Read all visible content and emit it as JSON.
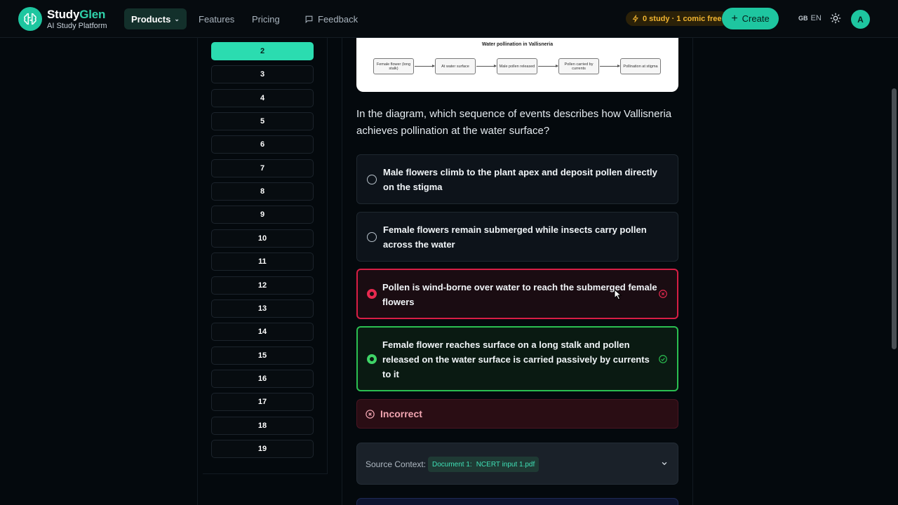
{
  "brand": {
    "name_main": "Study",
    "name_accent": "Glen",
    "tagline": "AI Study Platform"
  },
  "nav": {
    "products": "Products",
    "features": "Features",
    "pricing": "Pricing",
    "feedback": "Feedback"
  },
  "header": {
    "promo": "0 study · 1 comic free",
    "create": "Create",
    "lang_flag": "GB",
    "lang": "EN",
    "avatar": "A"
  },
  "question_nav": [
    "2",
    "3",
    "4",
    "5",
    "6",
    "7",
    "8",
    "9",
    "10",
    "11",
    "12",
    "13",
    "14",
    "15",
    "16",
    "17",
    "18",
    "19"
  ],
  "current_question": "2",
  "diagram": {
    "title": "Water pollination in Vallisneria",
    "steps": [
      "Female flower (long stalk)",
      "At water surface",
      "Male pollen released",
      "Pollen carried by currents",
      "Pollination at stigma"
    ]
  },
  "question": "In the diagram, which sequence of events describes how Vallisneria achieves pollination at the water surface?",
  "options": [
    {
      "text": "Male flowers climb to the plant apex and deposit pollen directly on the stigma",
      "state": "default"
    },
    {
      "text": "Female flowers remain submerged while insects carry pollen across the water",
      "state": "default"
    },
    {
      "text": "Pollen is wind-borne over water to reach the submerged female flowers",
      "state": "wrong"
    },
    {
      "text": "Female flower reaches surface on a long stalk and pollen released on the water surface is carried passively by currents to it",
      "state": "right"
    }
  ],
  "feedback": "Incorrect",
  "source": {
    "label": "Source Context:",
    "doc": "Document 1:",
    "file": "NCERT input 1.pdf"
  },
  "colors": {
    "accent": "#1ec6a0",
    "wrong": "#d81e45",
    "right": "#2bbf51",
    "promo": "#f2b530"
  }
}
